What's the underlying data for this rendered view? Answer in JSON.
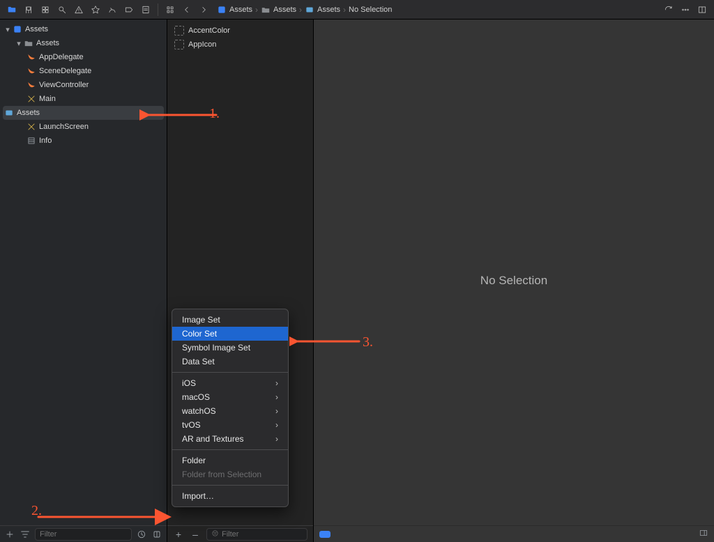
{
  "breadcrumb": {
    "seg1": "Assets",
    "seg2": "Assets",
    "seg3": "Assets",
    "seg4": "No Selection"
  },
  "navigator": {
    "root": "Assets",
    "group": "Assets",
    "items": {
      "appdelegate": "AppDelegate",
      "scenedelegate": "SceneDelegate",
      "viewcontroller": "ViewController",
      "main": "Main",
      "assets": "Assets",
      "launchscreen": "LaunchScreen",
      "info": "Info"
    },
    "filter_placeholder": "Filter"
  },
  "assets": {
    "accent": "AccentColor",
    "appicon": "AppIcon",
    "add_symbol": "+",
    "remove_symbol": "–",
    "filter_placeholder": "Filter"
  },
  "canvas": {
    "empty_text": "No Selection"
  },
  "context_menu": {
    "image_set": "Image Set",
    "color_set": "Color Set",
    "symbol_set": "Symbol Image Set",
    "data_set": "Data Set",
    "ios": "iOS",
    "macos": "macOS",
    "watchos": "watchOS",
    "tvos": "tvOS",
    "ar": "AR and Textures",
    "folder": "Folder",
    "folder_sel": "Folder from Selection",
    "import": "Import…"
  },
  "annotations": {
    "a1": "1.",
    "a2": "2.",
    "a3": "3."
  }
}
